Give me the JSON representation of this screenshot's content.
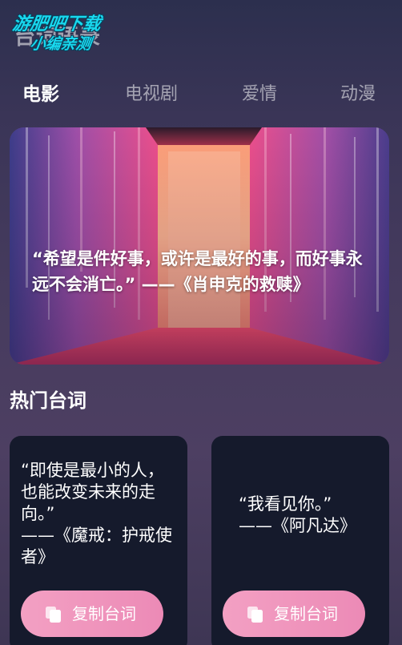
{
  "watermark": {
    "line1": "游肥吧下载",
    "line2": "小编亲测",
    "back_text": "台词语录"
  },
  "tabs": [
    {
      "label": "电影",
      "active": true
    },
    {
      "label": "电视剧",
      "active": false
    },
    {
      "label": "爱情",
      "active": false
    },
    {
      "label": "动漫",
      "active": false
    }
  ],
  "hero": {
    "quote": "“希望是件好事，或许是最好的事，而好事永远不会消亡。” ——《肖申克的救赎》"
  },
  "section": {
    "title": "热门台词"
  },
  "cards": [
    {
      "quote": "“即使是最小的人，也能改变未来的走向。”",
      "source": "——《魔戒：护戒使者》",
      "button_label": "复制台词"
    },
    {
      "quote": "“我看见你。”",
      "source": "——《阿凡达》",
      "button_label": "复制台词"
    }
  ],
  "colors": {
    "background": "#3a3557",
    "card": "#151a2c",
    "button": "#f3a0c3",
    "watermark": "#18d8ee"
  },
  "icons": {
    "copy": "copy-icon"
  }
}
